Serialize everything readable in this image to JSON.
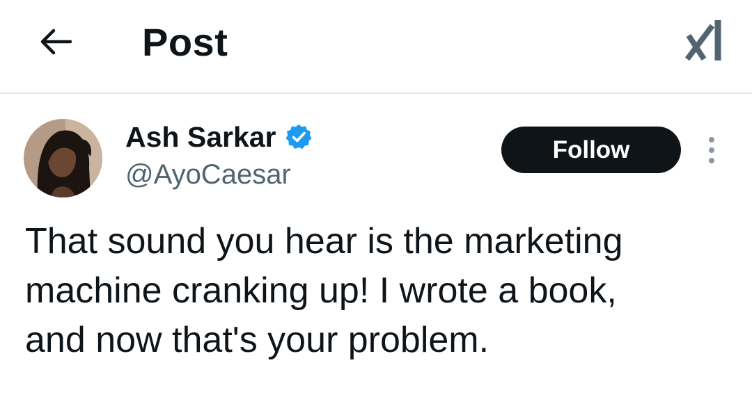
{
  "header": {
    "back_icon": "arrow-left-icon",
    "title": "Post",
    "grok_icon": "grok-icon"
  },
  "post": {
    "author": {
      "name": "Ash Sarkar",
      "handle": "@AyoCaesar",
      "verified": true,
      "verified_color": "#1d9bf0"
    },
    "follow_label": "Follow",
    "more_icon": "more-vertical-icon",
    "text": "That sound you hear is the marketing\nmachine cranking up! I wrote a book,\nand now that's your problem."
  },
  "colors": {
    "text_primary": "#0f1419",
    "text_secondary": "#536471",
    "follow_bg": "#0f1419",
    "follow_text": "#ffffff",
    "divider": "#e6e9ec"
  }
}
